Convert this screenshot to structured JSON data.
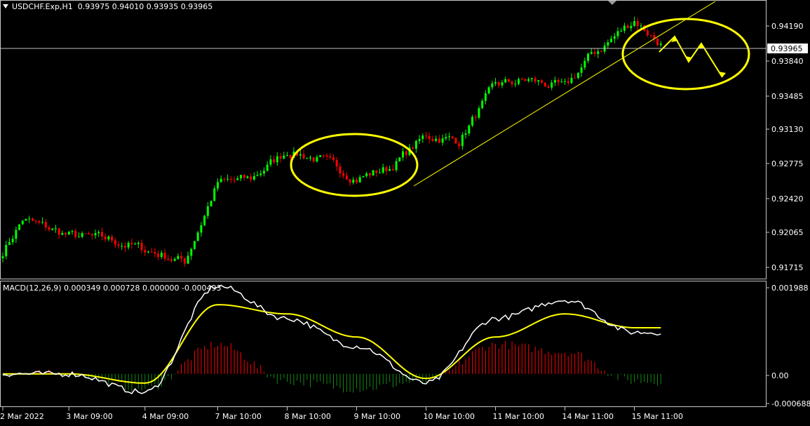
{
  "price_panel": {
    "symbol": "USDCHF.Exp,H1",
    "ohlc": [
      "0.93975",
      "0.94010",
      "0.93935",
      "0.93965"
    ],
    "current_price": "0.93965",
    "y_ticks": [
      "0.94190",
      "0.93840",
      "0.93485",
      "0.93130",
      "0.92775",
      "0.92420",
      "0.92065",
      "0.91715"
    ]
  },
  "macd_panel": {
    "label": "MACD(12,26,9)",
    "values": [
      "0.000349",
      "0.000728",
      "0.000000",
      "-0.000493"
    ],
    "y_ticks": [
      "0.001988",
      "0.00",
      "-0.000688"
    ]
  },
  "x_ticks": [
    "2 Mar 2022",
    "3 Mar 09:00",
    "4 Mar 09:00",
    "7 Mar 10:00",
    "8 Mar 10:00",
    "9 Mar 10:00",
    "10 Mar 10:00",
    "11 Mar 10:00",
    "14 Mar 11:00",
    "15 Mar 11:00"
  ],
  "colors": {
    "background": "#000000",
    "bull": "#00ff00",
    "bear": "#ff0000",
    "macd_line": "#ffffff",
    "signal_line": "#ffff00",
    "annotation": "#ffff00",
    "grid_text": "#ffffff"
  },
  "chart_data": [
    {
      "type": "candlestick",
      "title": "USDCHF.Exp,H1",
      "ylim": [
        0.9164,
        0.9438
      ],
      "close_path": [
        {
          "x": "2 Mar 2022",
          "y": 0.919
        },
        {
          "x": "2 Mar 2022 +6h",
          "y": 0.9222
        },
        {
          "x": "3 Mar 09:00",
          "y": 0.9206
        },
        {
          "x": "3 Mar 20:00",
          "y": 0.9202
        },
        {
          "x": "4 Mar 09:00",
          "y": 0.9192
        },
        {
          "x": "4 Mar 20:00",
          "y": 0.918
        },
        {
          "x": "7 Mar 10:00",
          "y": 0.9258
        },
        {
          "x": "7 Mar 20:00",
          "y": 0.9262
        },
        {
          "x": "8 Mar 10:00",
          "y": 0.929
        },
        {
          "x": "8 Mar 20:00",
          "y": 0.9281
        },
        {
          "x": "9 Mar 10:00",
          "y": 0.9263
        },
        {
          "x": "9 Mar 20:00",
          "y": 0.9273
        },
        {
          "x": "10 Mar 10:00",
          "y": 0.9305
        },
        {
          "x": "10 Mar 20:00",
          "y": 0.93
        },
        {
          "x": "11 Mar 10:00",
          "y": 0.9355
        },
        {
          "x": "11 Mar 20:00",
          "y": 0.936
        },
        {
          "x": "14 Mar 11:00",
          "y": 0.9352
        },
        {
          "x": "14 Mar 20:00",
          "y": 0.9385
        },
        {
          "x": "15 Mar 00:00",
          "y": 0.9392
        },
        {
          "x": "15 Mar 11:00",
          "y": 0.942
        },
        {
          "x": "15 Mar 20:00",
          "y": 0.9396
        }
      ],
      "annotations": [
        "ellipse around 9 Mar consolidation",
        "ascending trendline from 10 Mar",
        "ellipse around latest candles with projected zig-zag arrows"
      ]
    },
    {
      "type": "line",
      "title": "MACD(12,26,9)",
      "ylim": [
        -0.000688,
        0.001988
      ],
      "series": [
        {
          "name": "MACD",
          "x": [
            "2 Mar 2022",
            "3 Mar 09:00",
            "4 Mar 09:00",
            "7 Mar 10:00",
            "8 Mar 10:00",
            "9 Mar 10:00",
            "10 Mar 10:00",
            "11 Mar 10:00",
            "14 Mar 11:00",
            "15 Mar 11:00"
          ],
          "values": [
            0.0,
            0.0,
            -0.0004,
            0.0019,
            0.0012,
            0.0006,
            -0.0002,
            0.0012,
            0.0016,
            0.0009
          ]
        },
        {
          "name": "Signal",
          "x": [
            "2 Mar 2022",
            "3 Mar 09:00",
            "4 Mar 09:00",
            "7 Mar 10:00",
            "8 Mar 10:00",
            "9 Mar 10:00",
            "10 Mar 10:00",
            "11 Mar 10:00",
            "14 Mar 11:00",
            "15 Mar 11:00"
          ],
          "values": [
            0.0,
            0.0,
            -0.0002,
            0.0015,
            0.0013,
            0.0008,
            -0.0001,
            0.0008,
            0.0013,
            0.001
          ]
        }
      ]
    }
  ]
}
